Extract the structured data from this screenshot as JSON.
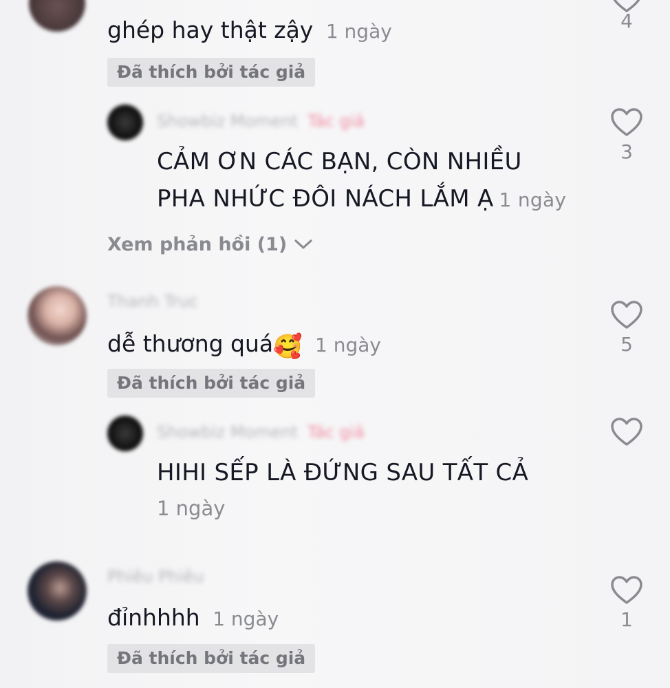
{
  "comments": [
    {
      "text": "ghép hay thật zậy",
      "time": "1 ngày",
      "liked_badge": "Đã thích bởi tác giả",
      "likes": "4"
    },
    {
      "reply": true,
      "author_tag": "Tác giả",
      "text_line1": "CẢM ƠN CÁC BẠN, CÒN NHIỀU",
      "text_line2": "PHA NHỨC ĐÔI NÁCH LẮM Ạ",
      "time": "1 ngày",
      "likes": "3",
      "view_replies": "Xem phản hồi (1)"
    },
    {
      "text": "dễ thương quá",
      "emoji": "🥰",
      "time": "1 ngày",
      "liked_badge": "Đã thích bởi tác giả",
      "likes": "5"
    },
    {
      "reply": true,
      "author_tag": "Tác giả",
      "text": "HIHI SẾP LÀ ĐỨNG SAU TẤT CẢ",
      "time": "1 ngày"
    },
    {
      "text": "đỉnhhhh",
      "time": "1 ngày",
      "liked_badge": "Đã thích bởi tác giả",
      "likes": "1"
    }
  ],
  "icons": {
    "heart": "heart-outline-icon",
    "chevron": "chevron-down-icon"
  },
  "colors": {
    "background": "#f6f6f7",
    "text": "#161823",
    "secondary": "#8a8b91",
    "badge_bg": "#e3e3e6",
    "author_tag": "#f08aa0"
  }
}
